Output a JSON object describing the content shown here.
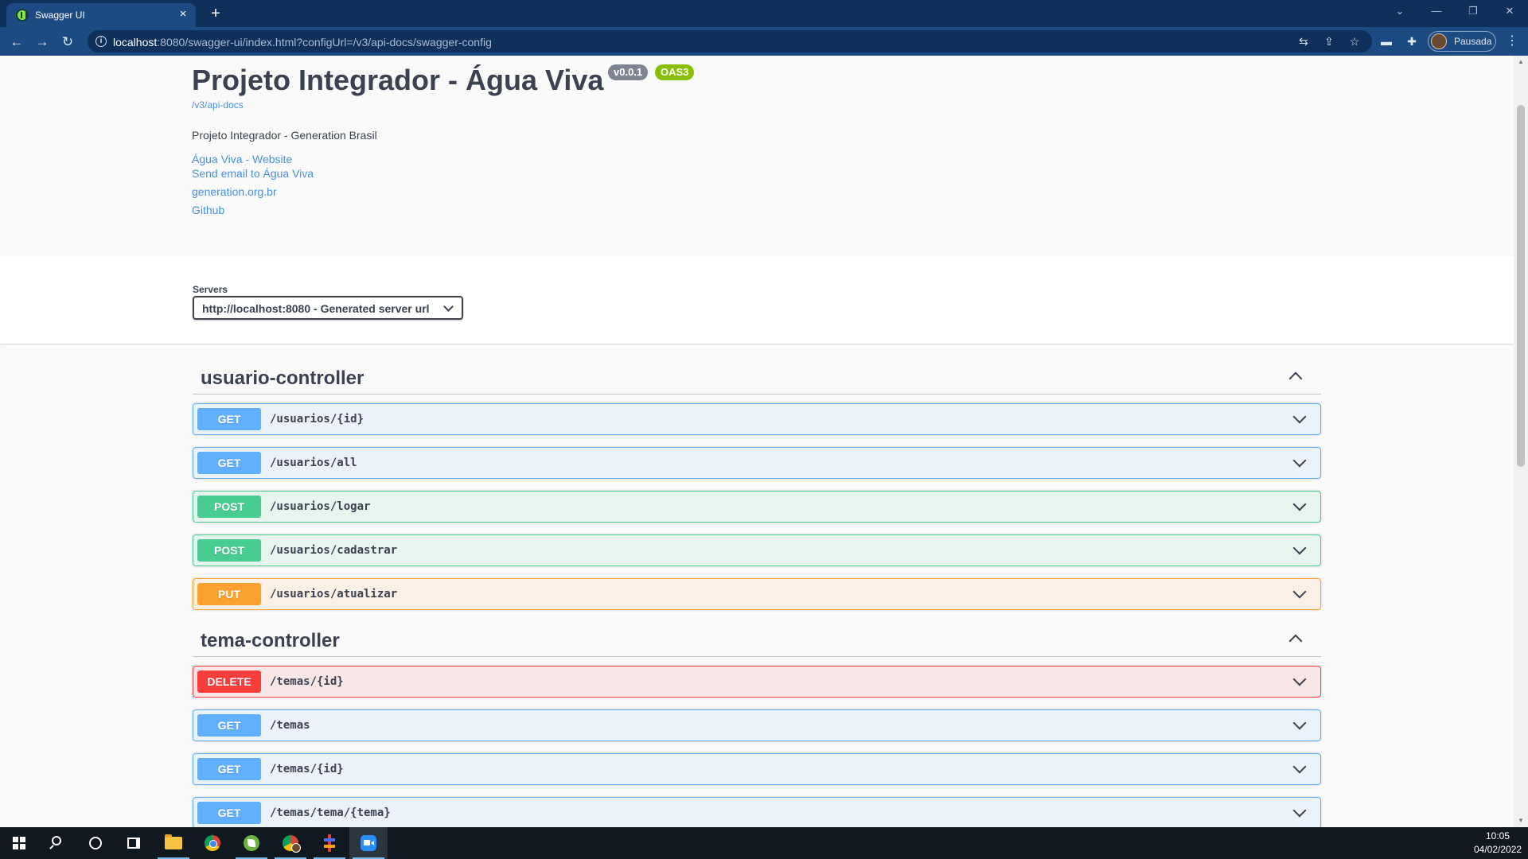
{
  "browser": {
    "tab_title": "Swagger UI",
    "tab_close_icon": "×",
    "new_tab_icon": "+",
    "url_host": "localhost",
    "url_rest": ":8080/swagger-ui/index.html?configUrl=/v3/api-docs/swagger-config",
    "profile_label": "Pausada"
  },
  "info": {
    "title": "Projeto Integrador - Água Viva",
    "version_badge": "v0.0.1",
    "oas_badge": "OAS3",
    "docs_link": "/v3/api-docs",
    "description": "Projeto Integrador - Generation Brasil",
    "links": [
      "Água Viva - Website",
      "Send email to Água Viva",
      "generation.org.br",
      "Github"
    ]
  },
  "servers": {
    "label": "Servers",
    "selected": "http://localhost:8080 - Generated server url"
  },
  "tags": [
    {
      "name": "usuario-controller",
      "operations": [
        {
          "method": "GET",
          "path": "/usuarios/{id}"
        },
        {
          "method": "GET",
          "path": "/usuarios/all"
        },
        {
          "method": "POST",
          "path": "/usuarios/logar"
        },
        {
          "method": "POST",
          "path": "/usuarios/cadastrar"
        },
        {
          "method": "PUT",
          "path": "/usuarios/atualizar"
        }
      ]
    },
    {
      "name": "tema-controller",
      "operations": [
        {
          "method": "DELETE",
          "path": "/temas/{id}"
        },
        {
          "method": "GET",
          "path": "/temas"
        },
        {
          "method": "GET",
          "path": "/temas/{id}"
        },
        {
          "method": "GET",
          "path": "/temas/tema/{tema}"
        }
      ]
    }
  ],
  "colors": {
    "get": "#61affe",
    "post": "#49cc90",
    "put": "#fca130",
    "delete": "#f93e3e",
    "link": "#4990e2",
    "text": "#3b4151",
    "chrome_dark": "#0f3058",
    "chrome_light": "#1d4a80"
  },
  "taskbar": {
    "time": "10:05",
    "date": "04/02/2022"
  }
}
